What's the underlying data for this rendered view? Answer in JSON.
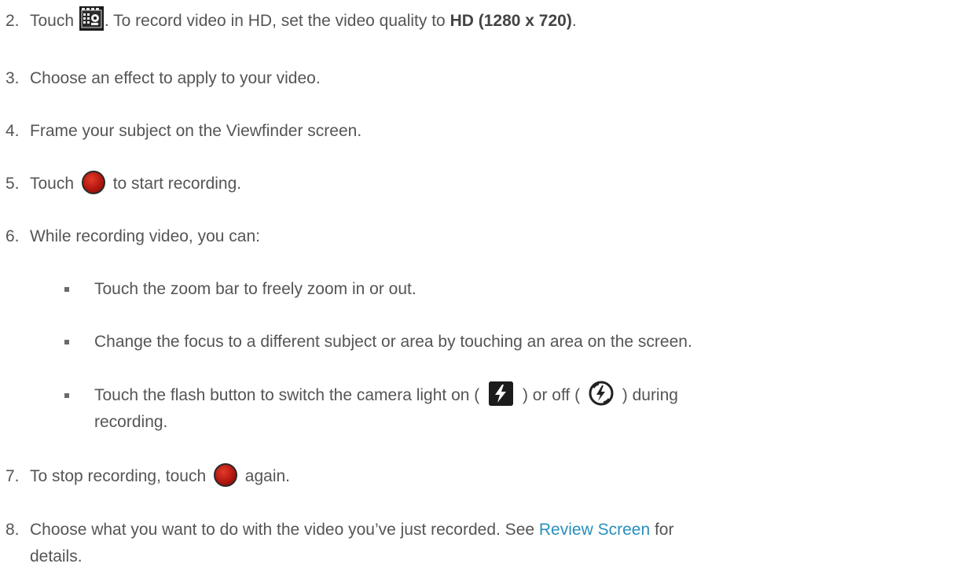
{
  "steps": {
    "s2": {
      "num": "2.",
      "pre": "Touch ",
      "mid": ". To record video in HD, set the video quality to ",
      "bold": "HD (1280 x 720)",
      "post": "."
    },
    "s3": {
      "num": "3.",
      "text": "Choose an effect to apply to your video."
    },
    "s4": {
      "num": "4.",
      "text": "Frame your subject on the Viewfinder screen."
    },
    "s5": {
      "num": "5.",
      "pre": "Touch ",
      "post": " to start recording."
    },
    "s6": {
      "num": "6.",
      "text": "While recording video, you can:"
    },
    "s7": {
      "num": "7.",
      "pre": "To stop recording, touch ",
      "post": " again."
    },
    "s8": {
      "num": "8.",
      "line1_pre": "Choose what you want to do with the video you’ve just recorded. See ",
      "link": "Review Screen",
      "line1_post": " for",
      "line2": "details."
    }
  },
  "bullets": {
    "b1": {
      "text": "Touch the zoom bar to freely zoom in or out."
    },
    "b2": {
      "text": "Change the focus to a different subject or area by touching an area on the screen."
    },
    "b3": {
      "pre": "Touch the flash button to switch the camera light on ( ",
      "mid": " ) or off ( ",
      "post": " ) during",
      "line2": "recording."
    }
  },
  "icons": {
    "settings": "video-settings-icon",
    "record": "record-button-icon",
    "flash_on": "flash-on-icon",
    "flash_off": "flash-off-icon"
  },
  "colors": {
    "text": "#555555",
    "link": "#2a8fbd",
    "record_red": "#b4170f"
  }
}
